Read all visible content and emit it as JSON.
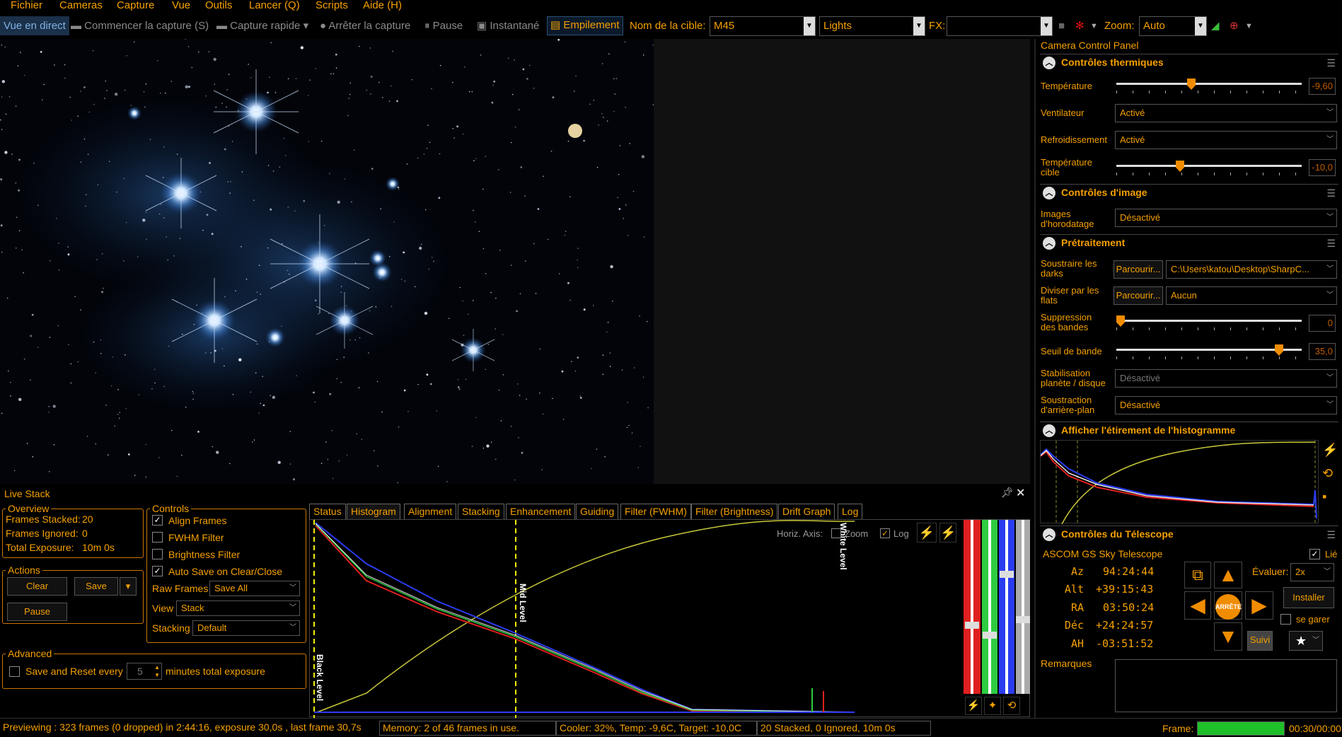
{
  "menu": [
    "Fichier",
    "Cameras",
    "Capture",
    "Vue",
    "Outils",
    "Lancer (Q)",
    "Scripts",
    "Aide (H)"
  ],
  "toolbar": {
    "live_view": "Vue en direct",
    "start_capture": "Commencer la capture (S)",
    "quick_capture": "Capture rapide",
    "stop_capture": "Arrêter la capture",
    "pause": "Pause",
    "snapshot": "Instantané",
    "stacking": "Empilement",
    "target_label": "Nom de la cible:",
    "target_value": "M45",
    "frame_type": "Lights",
    "fx_label": "FX:",
    "fx_value": "",
    "zoom_label": "Zoom:",
    "zoom_value": "Auto"
  },
  "right_panel": {
    "title": "Camera Control Panel",
    "thermal": {
      "header": "Contrôles thermiques",
      "temp_label": "Température",
      "temp_value": "-9,60",
      "fan_label": "Ventilateur",
      "fan_value": "Activé",
      "cooling_label": "Refroidissement",
      "cooling_value": "Activé",
      "target_temp_label_1": "Température",
      "target_temp_label_2": "cible",
      "target_temp_value": "-10,0"
    },
    "image": {
      "header": "Contrôles d'image",
      "timestamp_label_1": "Images",
      "timestamp_label_2": "d'horodatage",
      "timestamp_value": "Désactivé"
    },
    "preproc": {
      "header": "Prétraitement",
      "darks_label_1": "Soustraire les",
      "darks_label_2": "darks",
      "browse": "Parcourir...",
      "darks_path": "C:\\Users\\katou\\Desktop\\SharpC...",
      "flats_label_1": "Diviser par les",
      "flats_label_2": "flats",
      "flats_value": "Aucun",
      "banding_label_1": "Suppression",
      "banding_label_2": "des bandes",
      "banding_value": "0",
      "band_threshold_label": "Seuil de bande",
      "band_threshold_value": "35,0",
      "stabilize_label_1": "Stabilisation",
      "stabilize_label_2": "planète / disque",
      "stabilize_value": "Désactivé",
      "bg_sub_label_1": "Soustraction",
      "bg_sub_label_2": "d'arrière-plan",
      "bg_sub_value": "Désactivé"
    },
    "histo": {
      "header": "Afficher l'étirement de l'histogramme"
    },
    "telescope": {
      "header": "Contrôles du Télescope",
      "driver": "ASCOM GS Sky Telescope",
      "linked_label": "Lié",
      "az_label": "Az",
      "az_value": "94:24:44",
      "alt_label": "Alt",
      "alt_value": "+39:15:43",
      "ra_label": "RA",
      "ra_value": "03:50:24",
      "dec_label": "Déc",
      "dec_value": "+24:24:57",
      "ha_label": "AH",
      "ha_value": "-03:51:52",
      "stop_label": "ARRÊTE",
      "rate_label": "Évaluer:",
      "rate_value": "2x",
      "install_label": "Installer",
      "park_label": "se garer",
      "track_label": "Suivi",
      "remarks_label": "Remarques"
    }
  },
  "live_stack": {
    "title": "Live Stack",
    "overview": {
      "label": "Overview",
      "stacked_label": "Frames Stacked:",
      "stacked_value": "20",
      "ignored_label": "Frames Ignored:",
      "ignored_value": "0",
      "exposure_label": "Total Exposure:",
      "exposure_value": "10m 0s"
    },
    "actions": {
      "label": "Actions",
      "clear": "Clear",
      "save": "Save",
      "pause": "Pause"
    },
    "advanced": {
      "label": "Advanced",
      "save_reset_label": "Save and Reset every",
      "save_reset_value": "5",
      "save_reset_unit": "minutes total exposure"
    },
    "controls": {
      "label": "Controls",
      "align": "Align Frames",
      "fwhm": "FWHM Filter",
      "brightness": "Brightness Filter",
      "autosave": "Auto Save on Clear/Close",
      "raw_label": "Raw Frames",
      "raw_value": "Save All",
      "view_label": "View",
      "view_value": "Stack",
      "stacking_label": "Stacking",
      "stacking_value": "Default"
    },
    "tabs": [
      "Status",
      "Histogram",
      "Alignment",
      "Stacking",
      "Enhancement",
      "Guiding",
      "Filter (FWHM)",
      "Filter (Brightness)",
      "Drift Graph",
      "Log"
    ],
    "histogram": {
      "horiz_axis": "Horiz. Axis:",
      "zoom": "Zoom",
      "log": "Log",
      "black_level": "Black Level",
      "mid_level": "Mid Level",
      "white_level": "White Level"
    }
  },
  "status": {
    "preview": "Previewing : 323 frames (0 dropped) in 2:44:16, exposure 30,0s , last frame 30,7s",
    "memory": "Memory: 2 of 46 frames in use.",
    "cooler": "Cooler: 32%, Temp: -9,6C, Target: -10,0C",
    "stack": "20 Stacked, 0 Ignored, 10m 0s",
    "frame_label": "Frame:",
    "frame_progress": 1.0,
    "frame_time": "00:30/00:00"
  }
}
